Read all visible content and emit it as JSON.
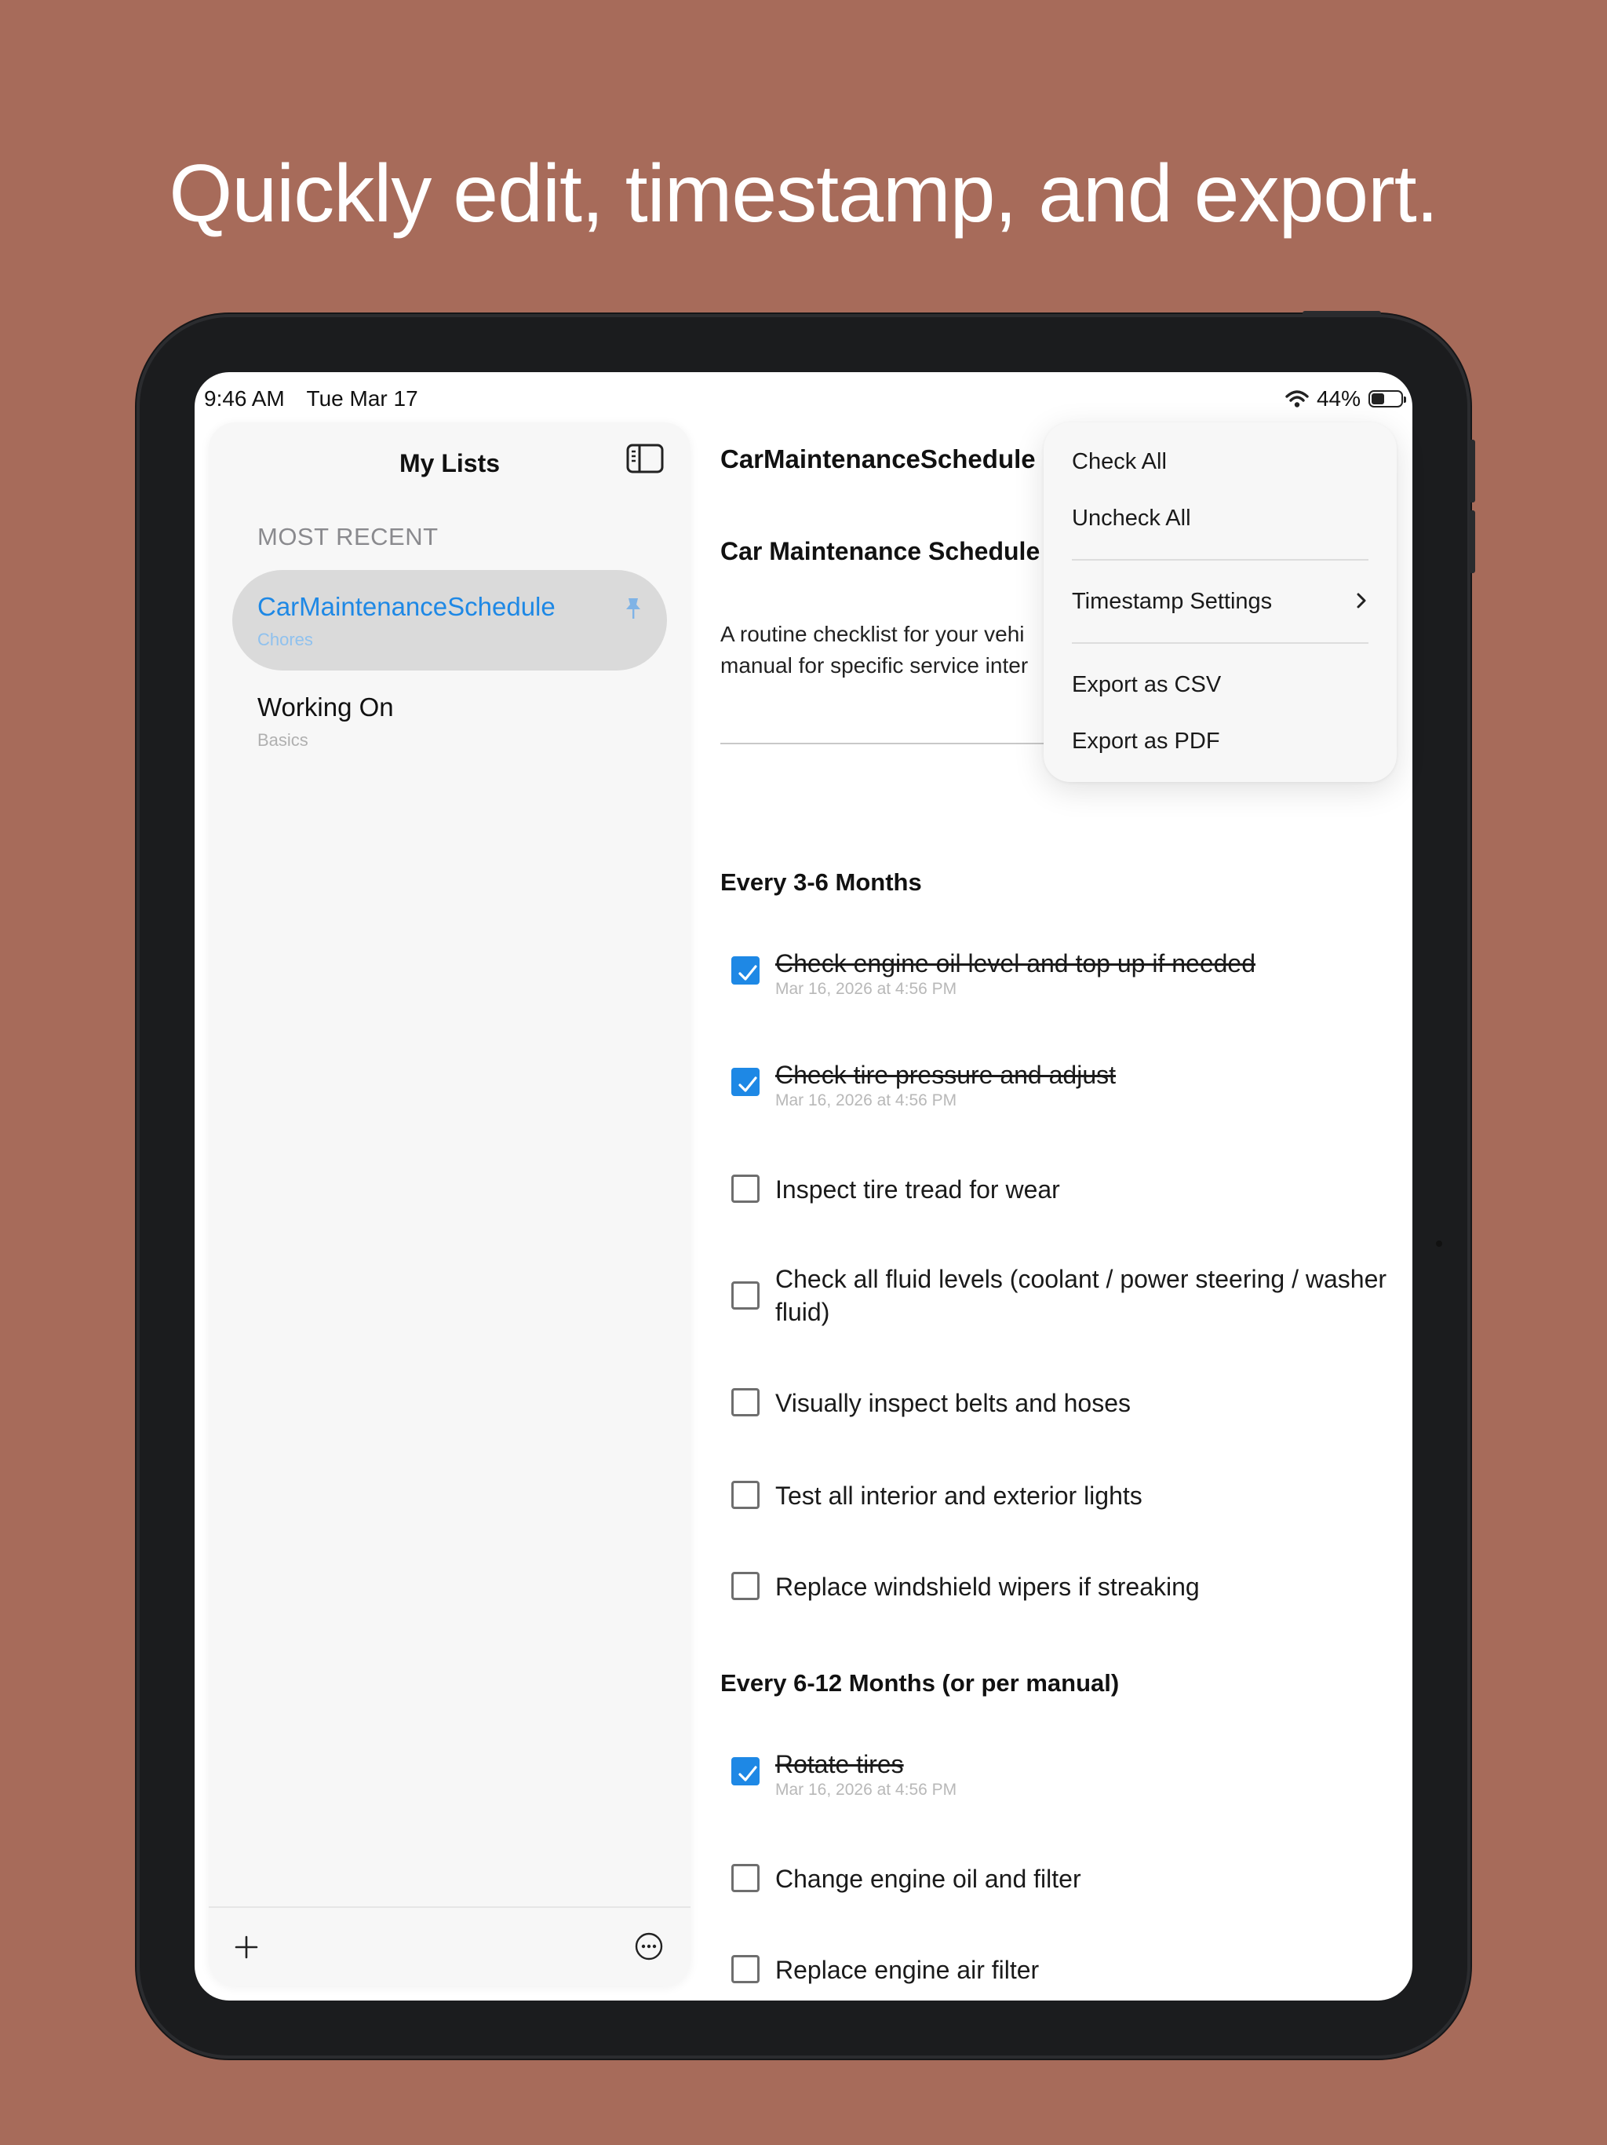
{
  "headline": "Quickly edit, timestamp, and export.",
  "status_bar": {
    "time": "9:46 AM",
    "date": "Tue Mar 17",
    "battery": "44%",
    "battery_level": 0.44
  },
  "sidebar": {
    "title": "My Lists",
    "section_label": "MOST RECENT",
    "items": [
      {
        "name": "CarMaintenanceSchedule",
        "category": "Chores",
        "selected": true,
        "pinned": true
      },
      {
        "name": "Working On",
        "category": "Basics",
        "selected": false,
        "pinned": false
      }
    ]
  },
  "main": {
    "nav_title": "CarMaintenanceSchedule",
    "doc_title": "Car Maintenance Schedule",
    "description_line1": "A routine checklist for your vehi",
    "description_line2": "manual for specific service inter",
    "sections": [
      {
        "title": "Every 3-6 Months",
        "items": [
          {
            "text": "Check engine oil level and top up if needed",
            "checked": true,
            "timestamp": "Mar 16, 2026 at 4:56 PM"
          },
          {
            "text": "Check tire pressure and adjust",
            "checked": true,
            "timestamp": "Mar 16, 2026 at 4:56 PM"
          },
          {
            "text": "Inspect tire tread for wear",
            "checked": false
          },
          {
            "text": "Check all fluid levels (coolant / power steering / washer fluid)",
            "checked": false
          },
          {
            "text": "Visually inspect belts and hoses",
            "checked": false
          },
          {
            "text": "Test all interior and exterior lights",
            "checked": false
          },
          {
            "text": "Replace windshield wipers if streaking",
            "checked": false
          }
        ]
      },
      {
        "title": "Every 6-12 Months (or per manual)",
        "items": [
          {
            "text": "Rotate tires",
            "checked": true,
            "timestamp": "Mar 16, 2026 at 4:56 PM"
          },
          {
            "text": "Change engine oil and filter",
            "checked": false
          },
          {
            "text": "Replace engine air filter",
            "checked": false
          }
        ]
      }
    ]
  },
  "menu": {
    "check_all": "Check All",
    "uncheck_all": "Uncheck All",
    "timestamp_settings": "Timestamp Settings",
    "export_csv": "Export as CSV",
    "export_pdf": "Export as PDF"
  },
  "colors": {
    "background": "#A76B5A",
    "accent": "#1E88E5",
    "device": "#1B1C1E"
  },
  "icons": [
    "sidebar-toggle-icon",
    "pin-icon",
    "plus-icon",
    "ellipsis-circle-icon",
    "chevron-right-icon",
    "wifi-icon",
    "battery-icon",
    "checkmark-icon"
  ]
}
